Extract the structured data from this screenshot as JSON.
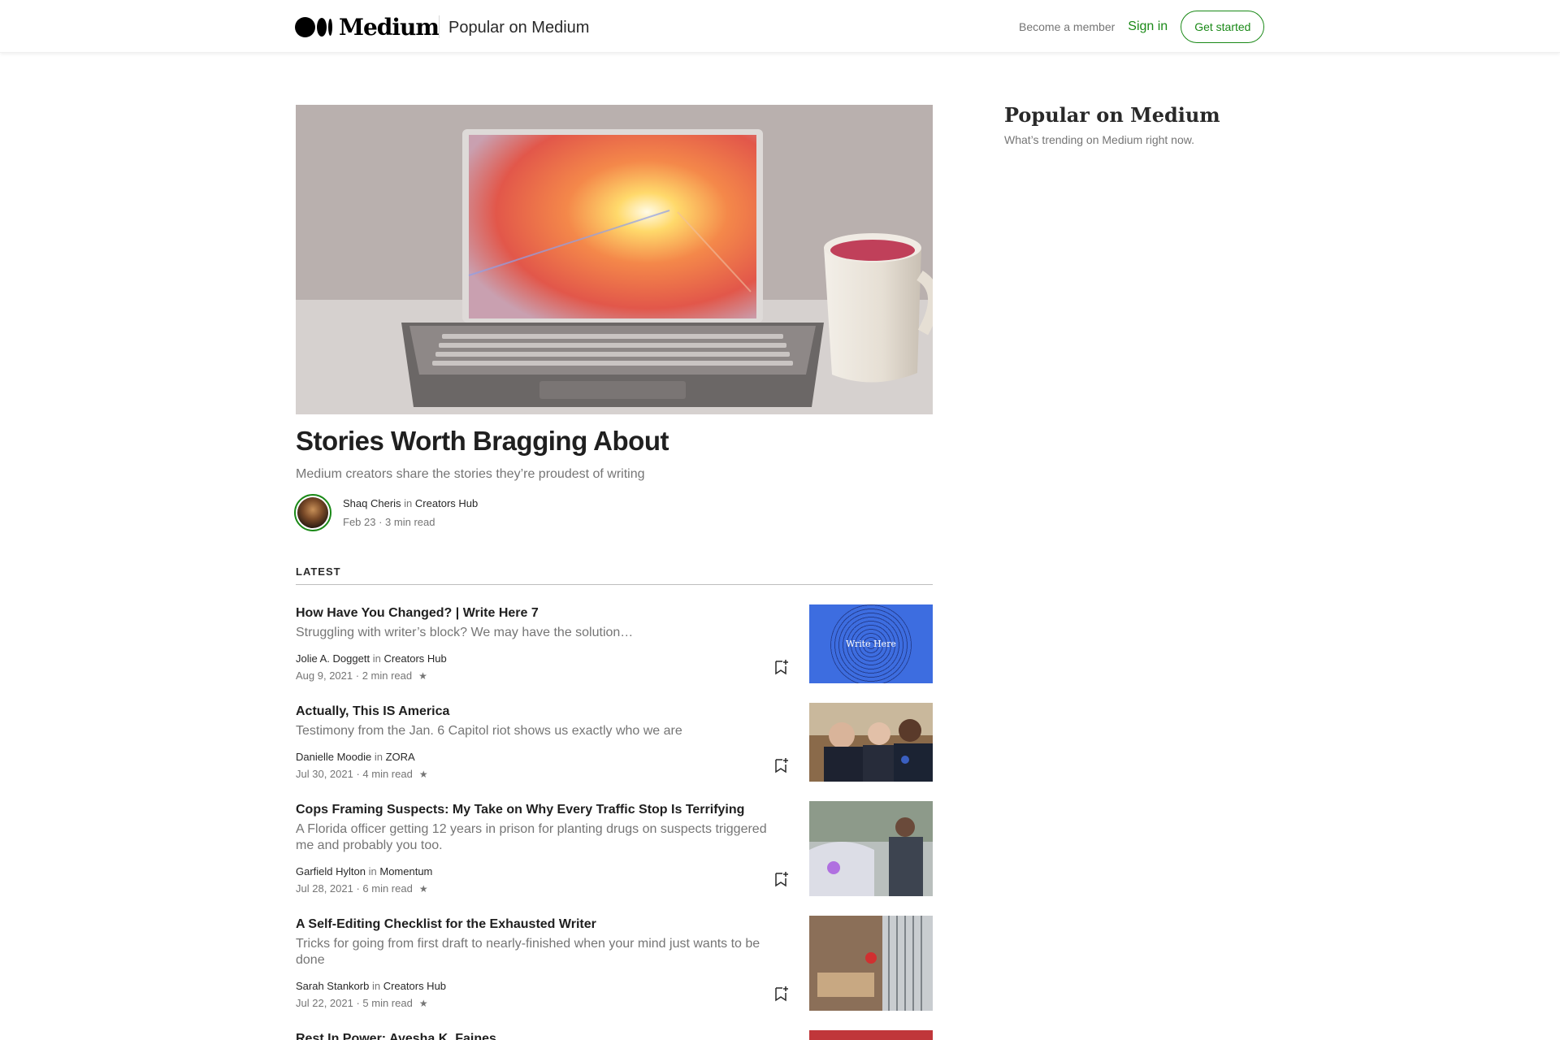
{
  "header": {
    "logo_text": "Medium",
    "publication_title": "Popular on Medium",
    "become_member": "Become a member",
    "sign_in": "Sign in",
    "get_started": "Get started"
  },
  "featured": {
    "title": "Stories Worth Bragging About",
    "subtitle": "Medium creators share the stories they’re proudest of writing",
    "author": "Shaq Cheris",
    "in_word": "in",
    "publication": "Creators Hub",
    "date": "Feb 23",
    "read_time": "3 min read"
  },
  "sidebar": {
    "title": "Popular on Medium",
    "subtitle": "What’s trending on Medium right now."
  },
  "latest": {
    "heading": "LATEST",
    "articles": [
      {
        "title": "How Have You Changed? | Write Here 7",
        "subtitle": "Struggling with writer’s block? We may have the solution…",
        "author": "Jolie A. Doggett",
        "publication": "Creators Hub",
        "date": "Aug 9, 2021",
        "read_time": "2 min read",
        "thumb_text": "Write Here"
      },
      {
        "title": "Actually, This IS America",
        "subtitle": "Testimony from the Jan. 6 Capitol riot shows us exactly who we are",
        "author": "Danielle Moodie",
        "publication": "ZORA",
        "date": "Jul 30, 2021",
        "read_time": "4 min read"
      },
      {
        "title": "Cops Framing Suspects: My Take on Why Every Traffic Stop Is Terrifying",
        "subtitle": "A Florida officer getting 12 years in prison for planting drugs on suspects triggered me and probably you too.",
        "author": "Garfield Hylton",
        "publication": "Momentum",
        "date": "Jul 28, 2021",
        "read_time": "6 min read"
      },
      {
        "title": "A Self-Editing Checklist for the Exhausted Writer",
        "subtitle": "Tricks for going from first draft to nearly-finished when your mind just wants to be done",
        "author": "Sarah Stankorb",
        "publication": "Creators Hub",
        "date": "Jul 22, 2021",
        "read_time": "5 min read"
      },
      {
        "title": "Rest In Power: Ayesha K. Faines"
      }
    ]
  },
  "colors": {
    "accent_green": "#1a8917",
    "text": "#292929",
    "muted": "#757575"
  },
  "icons": [
    "bookmark-add-icon",
    "star-icon"
  ]
}
